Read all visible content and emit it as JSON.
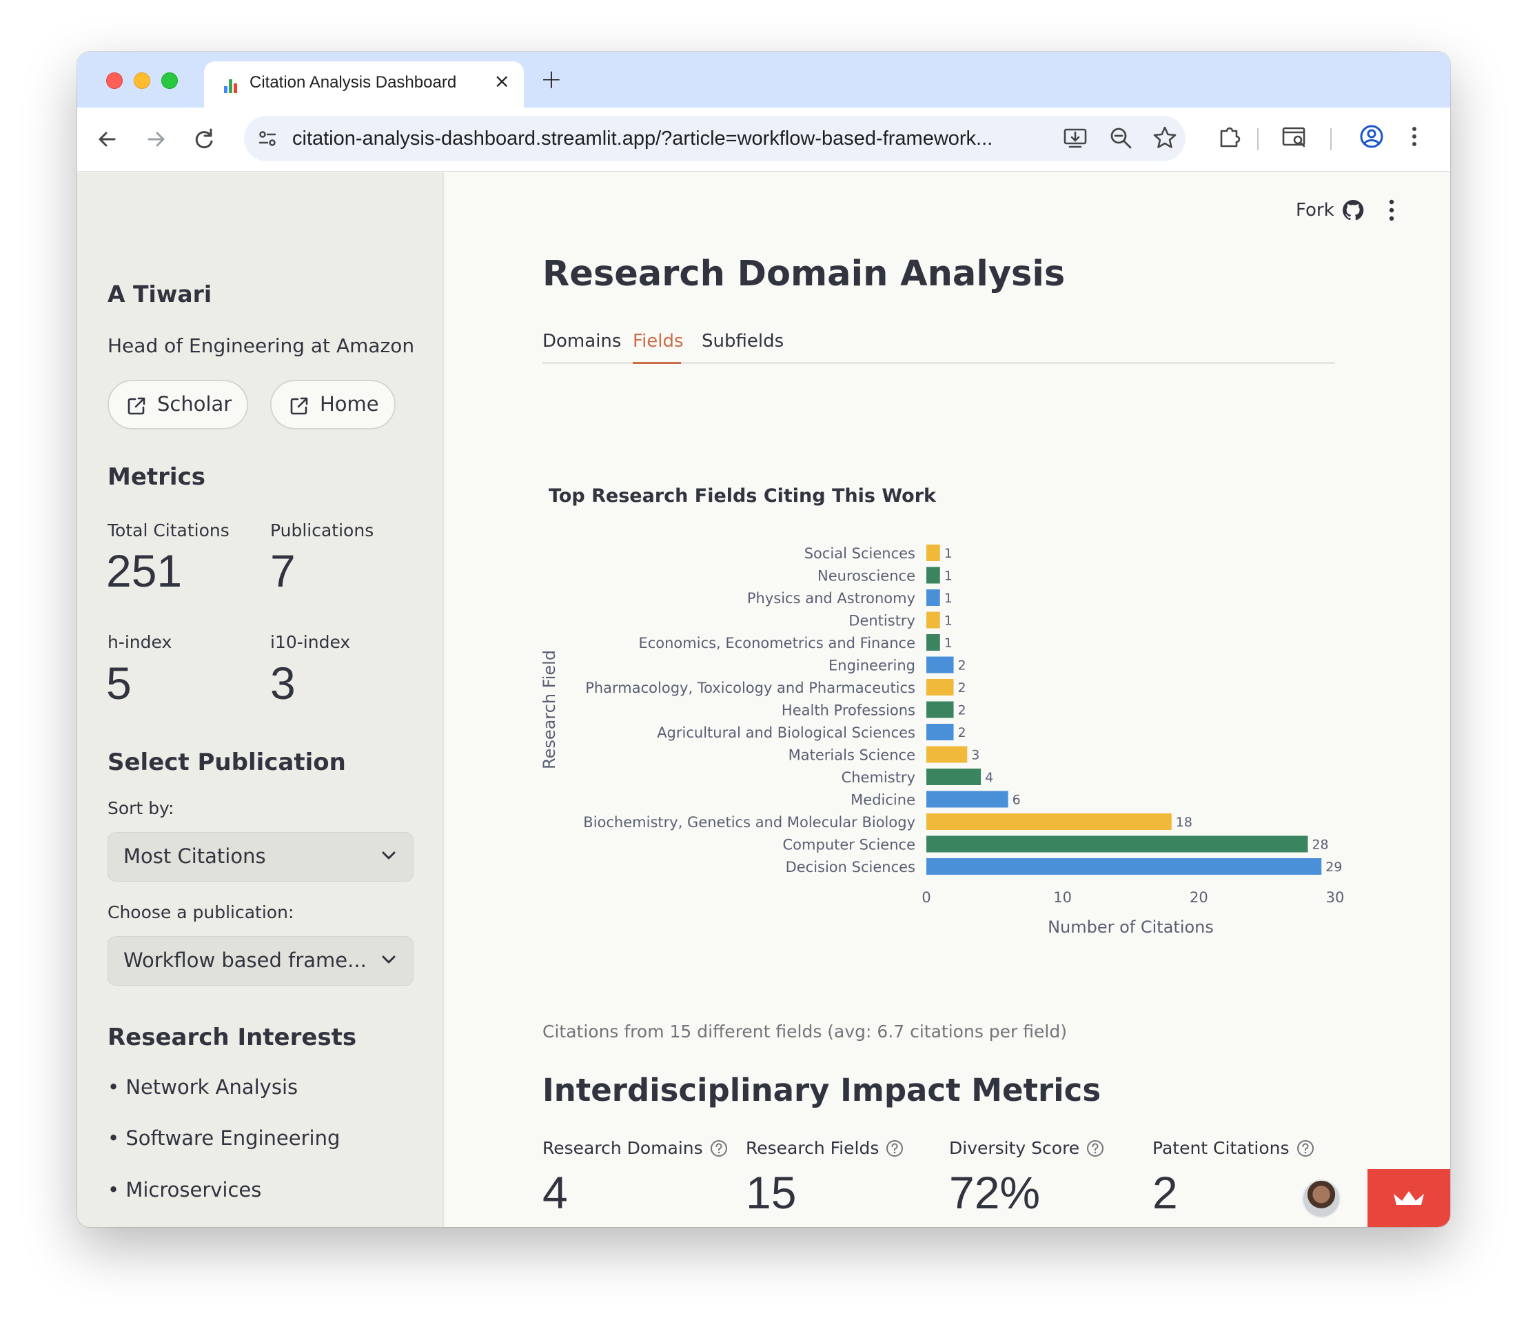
{
  "browser": {
    "tab_title": "Citation Analysis Dashboard",
    "tab_close": "×",
    "new_tab": "+",
    "url": "citation-analysis-dashboard.streamlit.app/?article=workflow-based-framework..."
  },
  "header": {
    "fork_label": "Fork"
  },
  "sidebar": {
    "name": "A Tiwari",
    "role": "Head of Engineering at Amazon",
    "scholar_label": "Scholar",
    "home_label": "Home",
    "metrics_heading": "Metrics",
    "metrics": [
      {
        "label": "Total Citations",
        "value": "251"
      },
      {
        "label": "Publications",
        "value": "7"
      },
      {
        "label": "h-index",
        "value": "5"
      },
      {
        "label": "i10-index",
        "value": "3"
      }
    ],
    "select_heading": "Select Publication",
    "sort_label": "Sort by:",
    "sort_value": "Most Citations",
    "choose_label": "Choose a publication:",
    "choose_value": "Workflow based frame...",
    "interests_heading": "Research Interests",
    "interests": [
      "• Network Analysis",
      "• Software Engineering",
      "• Microservices"
    ]
  },
  "main": {
    "title": "Research Domain Analysis",
    "tabs": [
      "Domains",
      "Fields",
      "Subfields"
    ],
    "active_tab": "Fields",
    "caption": "Citations from 15 different fields (avg: 6.7 citations per field)",
    "impact_heading": "Interdisciplinary Impact Metrics",
    "impact": [
      {
        "label": "Research Domains",
        "value": "4"
      },
      {
        "label": "Research Fields",
        "value": "15"
      },
      {
        "label": "Diversity Score",
        "value": "72%"
      },
      {
        "label": "Patent Citations",
        "value": "2"
      }
    ]
  },
  "colors": {
    "accent": "#cb6c4a",
    "bar_blue": "#4a90d9",
    "bar_green": "#3a855f",
    "bar_yellow": "#f0b93a",
    "deploy_red": "#e8453c"
  },
  "chart_data": {
    "type": "bar",
    "orientation": "horizontal",
    "title": "Top Research Fields Citing This Work",
    "xlabel": "Number of Citations",
    "ylabel": "Research Field",
    "xlim": [
      0,
      30
    ],
    "xticks": [
      0,
      10,
      20,
      30
    ],
    "categories": [
      "Social Sciences",
      "Neuroscience",
      "Physics and Astronomy",
      "Dentistry",
      "Economics, Econometrics and Finance",
      "Engineering",
      "Pharmacology, Toxicology and Pharmaceutics",
      "Health Professions",
      "Agricultural and Biological Sciences",
      "Materials Science",
      "Chemistry",
      "Medicine",
      "Biochemistry, Genetics and Molecular Biology",
      "Computer Science",
      "Decision Sciences"
    ],
    "values": [
      1,
      1,
      1,
      1,
      1,
      2,
      2,
      2,
      2,
      3,
      4,
      6,
      18,
      28,
      29
    ],
    "bar_colors": [
      "#f0b93a",
      "#3a855f",
      "#4a90d9",
      "#f0b93a",
      "#3a855f",
      "#4a90d9",
      "#f0b93a",
      "#3a855f",
      "#4a90d9",
      "#f0b93a",
      "#3a855f",
      "#4a90d9",
      "#f0b93a",
      "#3a855f",
      "#4a90d9"
    ],
    "grid": false,
    "data_labels": true
  }
}
